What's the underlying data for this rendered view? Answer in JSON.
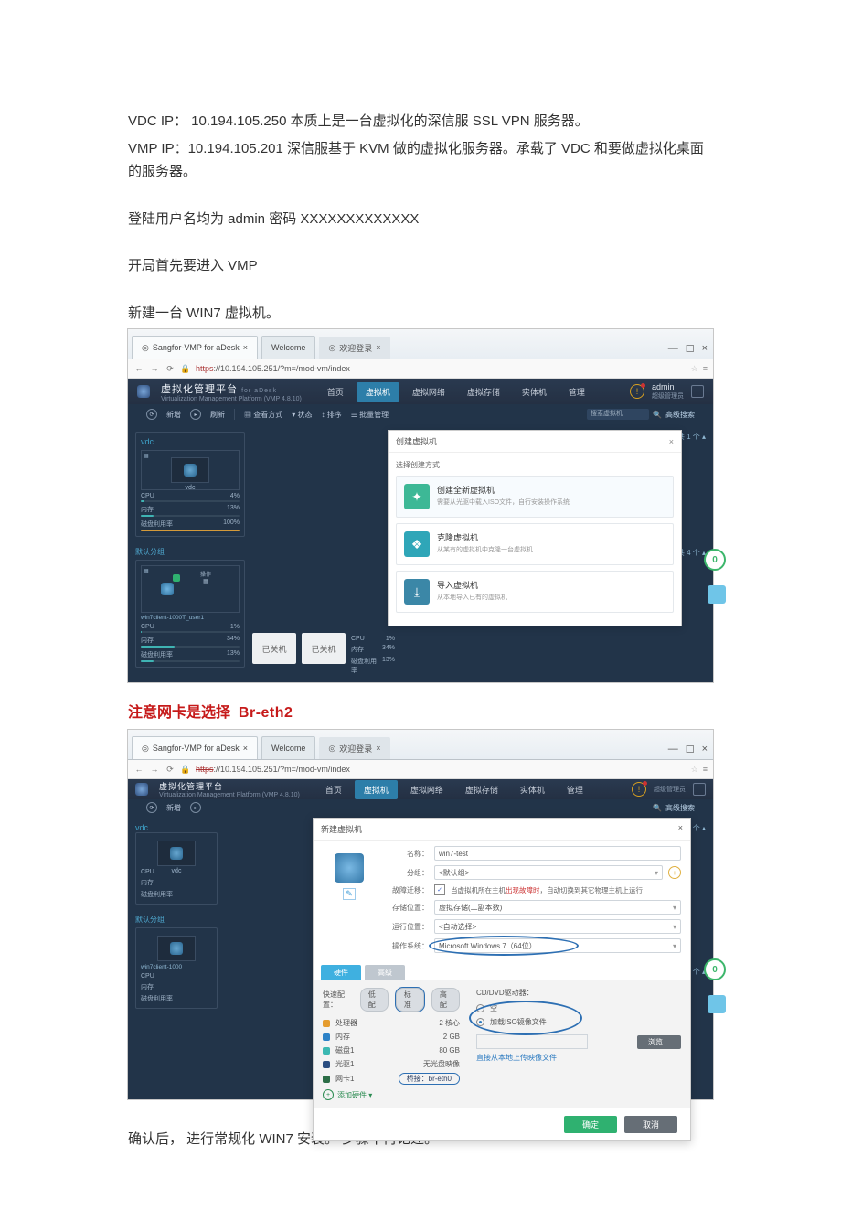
{
  "text": {
    "vdc_line": "VDC IP：  10.194.105.250      本质上是一台虚拟化的深信服 SSL VPN 服务器。",
    "vmp_line": "VMP IP：10.194.105.201       深信服基于 KVM 做的虚拟化服务器。承载了 VDC 和要做虚拟化桌面的服务器。",
    "login_line": "登陆用户名均为 admin  密码  XXXXXXXXXXXXX",
    "step_line": "开局首先要进入 VMP",
    "newvm_line": "新建一台 WIN7 虚拟机。",
    "red_note_a": "注意网卡是选择",
    "red_note_b": "Br-eth2",
    "confirm_line": "确认后， 进行常规化 WIN7 安装。 步骤不再论述。"
  },
  "chrome": {
    "tab1": "Sangfor-VMP for aDesk",
    "tab2": "Welcome",
    "tab3": "欢迎登录",
    "win_min": "—",
    "win_max": "☐",
    "win_close": "×",
    "url_strike": "https",
    "url_rest": "://10.194.105.251/?m=/mod-vm/index",
    "star": "☆",
    "menu": "≡"
  },
  "app": {
    "brand": "虚拟化管理平台",
    "brand_sub": "Virtualization Management Platform (VMP 4.8.10)",
    "brand_sup": "for aDesk",
    "nav_home": "首页",
    "nav_vm": "虚拟机",
    "nav_net": "虚拟网络",
    "nav_store": "虚拟存储",
    "nav_host": "实体机",
    "nav_manage": "管理",
    "alert": "!",
    "user_name": "admin",
    "user_role": "超级管理员",
    "tb_new": "新增",
    "tb_refresh": "刷新",
    "tb_layout": "查看方式",
    "tb_status": "状态",
    "tb_sort": "排序",
    "tb_batch": "批量管理",
    "tb_search_ph": "搜索虚拟机",
    "tb_adv": "高级搜索"
  },
  "left": {
    "vdc_title": "vdc",
    "vdc_sub": "vdc",
    "cpu": "CPU",
    "cpu_v": "4%",
    "mem": "内存",
    "mem_v": "13%",
    "disk": "磁盘利用率",
    "disk_v": "100%",
    "group": "默认分组",
    "vm_name": "win7client-1000T_user1",
    "state_off": "已关机",
    "mini_cpu": "CPU",
    "mini_cpu_v": "1%",
    "mini_mem": "内存",
    "mini_mem_v": "34%",
    "mini_disk": "磁盘利用率",
    "mini_disk_v": "13%",
    "badge_op": "操作"
  },
  "right_panel": {
    "count1": "共 1 个",
    "count4": "共 4 个",
    "cpu": "CPU",
    "cpu_v": "1%",
    "mem": "内存",
    "mem_v": "34%",
    "disk": "磁盘利用率",
    "disk_v": "13%"
  },
  "modal1": {
    "title": "创建虚拟机",
    "close": "×",
    "sub": "选择创建方式",
    "o1_t": "创建全新虚拟机",
    "o1_d": "需要从光驱中载入ISO文件，自行安装操作系统",
    "o2_t": "克隆虚拟机",
    "o2_d": "从某有的虚拟机中克隆一台虚拟机",
    "o3_t": "导入虚拟机",
    "o3_d": "从本地导入已有的虚拟机"
  },
  "left2": {
    "vdc": "vdc",
    "vm_name2": "win7client-1000",
    "cpu": "CPU",
    "mem": "内存",
    "disk": "磁盘利用率"
  },
  "modal2": {
    "title": "新建虚拟机",
    "close": "×",
    "edit": "✎",
    "f_name": "名称：",
    "v_name": "win7-test",
    "f_group": "分组：",
    "v_group": "<默认组>",
    "f_migrate": "故障迁移：",
    "v_migrate": "当虚拟机所在主机出现故障时，自动切换到其它物理主机上运行",
    "f_storeloc": "存储位置：",
    "v_storeloc": "虚拟存储(二副本数)",
    "f_runloc": "运行位置：",
    "v_runloc": "<自动选择>",
    "f_os": "操作系统：",
    "v_os": "Microsoft Windows 7（64位）",
    "tab_hw": "硬件",
    "tab_adv": "高级",
    "quick_lbl": "快速配置：",
    "pill_low": "低配",
    "pill_std": "标准",
    "pill_high": "高配",
    "hw_cpu": "处理器",
    "hw_cpu_v": "2 核心",
    "hw_mem": "内存",
    "hw_mem_v": "2 GB",
    "hw_disk": "磁盘1",
    "hw_disk_v": "80 GB",
    "hw_cd": "光驱1",
    "hw_cd_v": "无光盘映像",
    "hw_nic": "网卡1",
    "hw_nic_v": "桥接：br-eth0",
    "add_hw": "添加硬件 ▾",
    "cd_section": "CD/DVD驱动器：",
    "r_empty": "空",
    "r_iso": "加载ISO镜像文件",
    "upload_hint": "直接从本地上传映像文件",
    "browse": "浏览…",
    "ok": "确定",
    "cancel": "取消"
  },
  "badge_zero": "0"
}
